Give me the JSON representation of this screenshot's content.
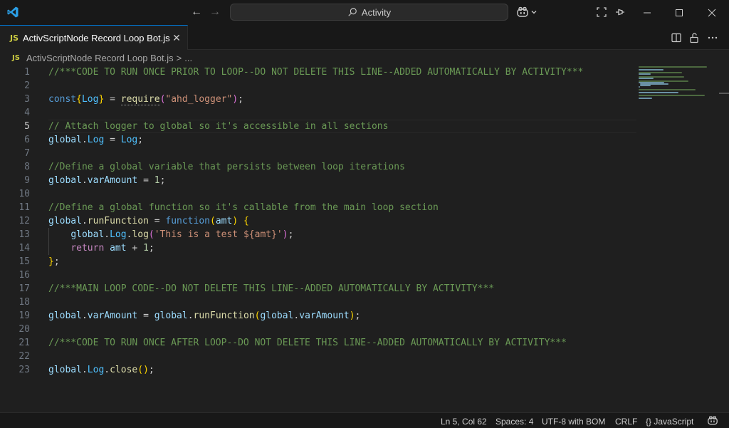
{
  "titlebar": {
    "search_text": "Activity",
    "icons": [
      "vscode-logo",
      "arrow-left-icon",
      "arrow-right-icon",
      "search-icon",
      "copilot-icon",
      "chevron-down-icon",
      "layout-icon",
      "pin-icon",
      "minimize-icon",
      "maximize-icon",
      "close-icon"
    ]
  },
  "tab": {
    "badge": "JS",
    "label": "ActivScriptNode Record Loop Bot.js",
    "close_glyph": "✕"
  },
  "breadcrumb": {
    "badge": "JS",
    "file": "ActivScriptNode Record Loop Bot.js",
    "separator": ">",
    "more": "..."
  },
  "editor": {
    "active_line": 5,
    "line_numbers": [
      "1",
      "2",
      "3",
      "4",
      "5",
      "6",
      "7",
      "8",
      "9",
      "10",
      "11",
      "12",
      "13",
      "14",
      "15",
      "16",
      "17",
      "18",
      "19",
      "20",
      "21",
      "22",
      "23"
    ],
    "lines": {
      "l1": "//***CODE TO RUN ONCE PRIOR TO LOOP--DO NOT DELETE THIS LINE--ADDED AUTOMATICALLY BY ACTIVITY***",
      "l3": {
        "kw": "const",
        "ob": "{",
        "var": "Log",
        "cb": "}",
        "eq": " = ",
        "fn": "require",
        "op": "(",
        "str": "\"ahd_logger\"",
        "cp": ")",
        "end": ";"
      },
      "l5": "// Attach logger to global so it's accessible in all sections",
      "l6": {
        "a": "global",
        "dot": ".",
        "b": "Log",
        "eq": " = ",
        "c": "Log",
        "end": ";"
      },
      "l8": "//Define a global variable that persists between loop iterations",
      "l9": {
        "a": "global",
        "dot": ".",
        "b": "varAmount",
        "eq": " = ",
        "num": "1",
        "end": ";"
      },
      "l11": "//Define a global function so it's callable from the main loop section",
      "l12": {
        "a": "global",
        "dot": ".",
        "fn": "runFunction",
        "eq": " = ",
        "kw": "function",
        "op": "(",
        "arg": "amt",
        "cp": ")",
        "sp": " ",
        "ob": "{"
      },
      "l13": {
        "indent": "    ",
        "a": "global",
        "dot1": ".",
        "b": "Log",
        "dot2": ".",
        "fn": "log",
        "op": "(",
        "str": "'This is a test ${amt}'",
        "cp": ")",
        "end": ";"
      },
      "l14": {
        "indent": "    ",
        "kw": "return",
        "sp": " ",
        "arg": "amt",
        "op": " + ",
        "num": "1",
        "end": ";"
      },
      "l15": {
        "cb": "}",
        "end": ";"
      },
      "l17": "//***MAIN LOOP CODE--DO NOT DELETE THIS LINE--ADDED AUTOMATICALLY BY ACTIVITY***",
      "l19": {
        "a": "global",
        "dot1": ".",
        "b": "varAmount",
        "eq": " = ",
        "c": "global",
        "dot2": ".",
        "fn": "runFunction",
        "op": "(",
        "d": "global",
        "dot3": ".",
        "e": "varAmount",
        "cp": ")",
        "end": ";"
      },
      "l21": "//***CODE TO RUN ONCE AFTER LOOP--DO NOT DELETE THIS LINE--ADDED AUTOMATICALLY BY ACTIVITY***",
      "l23": {
        "a": "global",
        "dot1": ".",
        "b": "Log",
        "dot2": ".",
        "fn": "close",
        "op": "(",
        "cp": ")",
        "end": ";"
      }
    }
  },
  "statusbar": {
    "position": "Ln 5, Col 62",
    "spaces": "Spaces: 4",
    "encoding": "UTF-8 with BOM",
    "eol": "CRLF",
    "language_braces": "{}",
    "language": "JavaScript"
  },
  "colors": {
    "accent": "#0078d4",
    "comment": "#6a9955",
    "keyword": "#569cd6",
    "variable": "#9cdcfe",
    "function": "#dcdcaa",
    "string": "#ce9178",
    "number": "#b5cea8"
  }
}
